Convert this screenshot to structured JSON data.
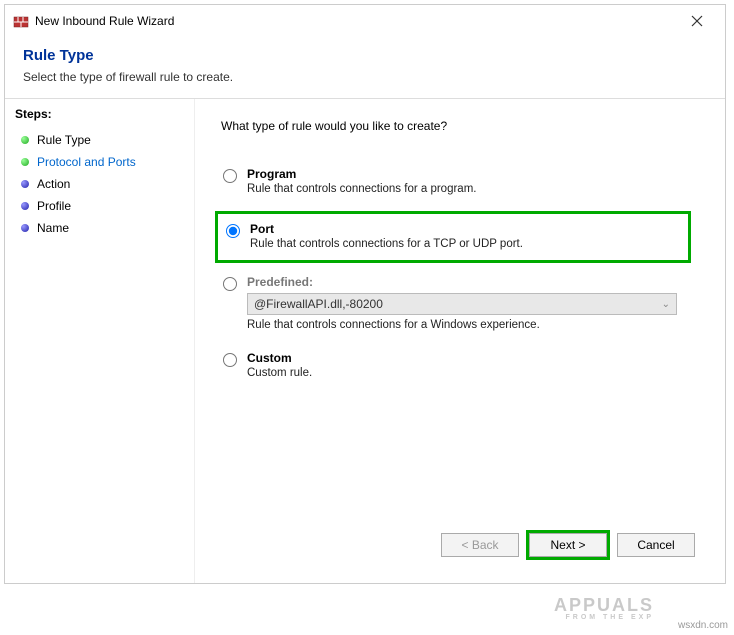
{
  "window": {
    "title": "New Inbound Rule Wizard"
  },
  "header": {
    "title": "Rule Type",
    "subtitle": "Select the type of firewall rule to create."
  },
  "sidebar": {
    "heading": "Steps:",
    "items": [
      {
        "label": "Rule Type",
        "bullet": "green",
        "active": false
      },
      {
        "label": "Protocol and Ports",
        "bullet": "green",
        "active": true
      },
      {
        "label": "Action",
        "bullet": "blue",
        "active": false
      },
      {
        "label": "Profile",
        "bullet": "blue",
        "active": false
      },
      {
        "label": "Name",
        "bullet": "blue",
        "active": false
      }
    ]
  },
  "content": {
    "prompt": "What type of rule would you like to create?",
    "options": {
      "program": {
        "label": "Program",
        "desc": "Rule that controls connections for a program."
      },
      "port": {
        "label": "Port",
        "desc": "Rule that controls connections for a TCP or UDP port."
      },
      "predefined": {
        "label": "Predefined:",
        "desc": "Rule that controls connections for a Windows experience.",
        "select_value": "@FirewallAPI.dll,-80200"
      },
      "custom": {
        "label": "Custom",
        "desc": "Custom rule."
      }
    },
    "selected": "port"
  },
  "footer": {
    "back": "< Back",
    "next": "Next >",
    "cancel": "Cancel"
  },
  "watermark": {
    "site": "wsxdn.com",
    "brand": "APPUALS",
    "brand_sub": "FROM   THE   EXP"
  }
}
